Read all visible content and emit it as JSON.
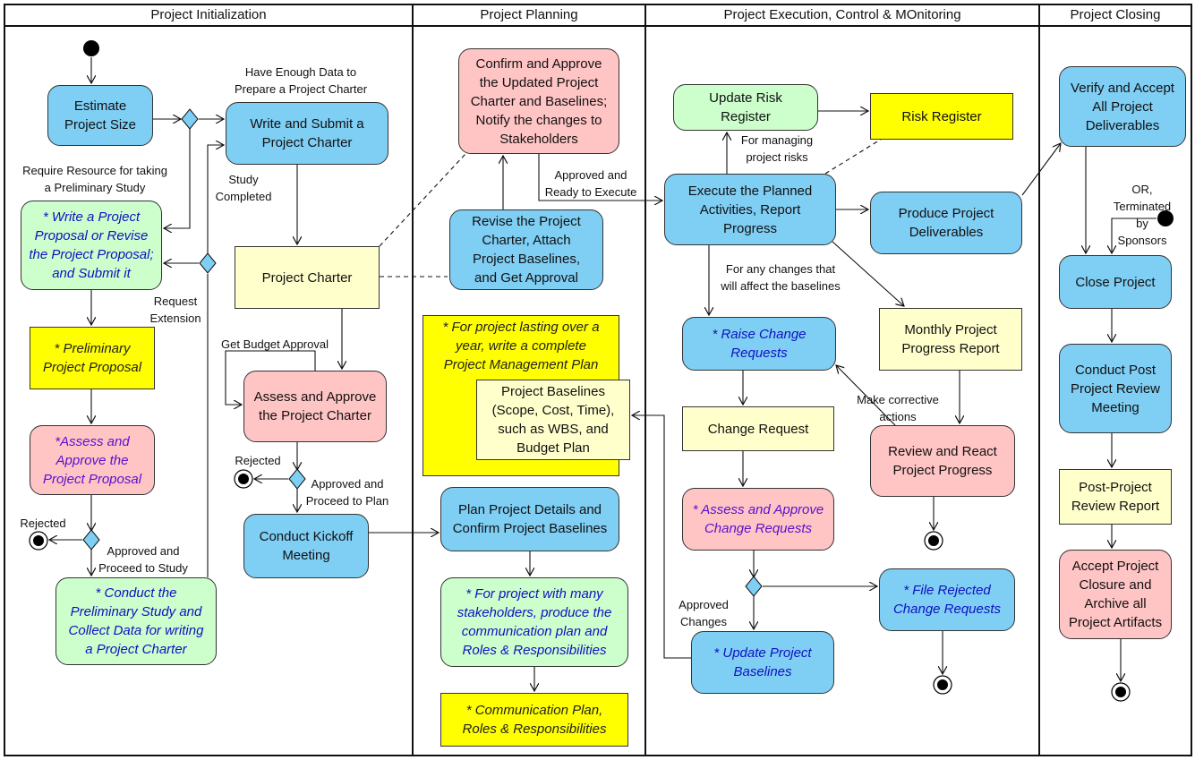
{
  "lanes": [
    {
      "id": "init",
      "title": "Project Initialization"
    },
    {
      "id": "plan",
      "title": "Project Planning"
    },
    {
      "id": "exec",
      "title": "Project Execution, Control & MOnitoring"
    },
    {
      "id": "close",
      "title": "Project Closing"
    }
  ],
  "nodes": [
    {
      "id": "n1",
      "text": "Estimate\nProject Size",
      "style": "blue rounded"
    },
    {
      "id": "n2",
      "text": "Write and Submit a\nProject Charter",
      "style": "blue rounded"
    },
    {
      "id": "n3",
      "text": "* Write a Project\nProposal or Revise\nthe Project Proposal;\nand Submit it",
      "style": "green rounded it"
    },
    {
      "id": "n4",
      "text": "Project Charter",
      "style": "lyellow"
    },
    {
      "id": "n5",
      "text": "* Preliminary\nProject Proposal",
      "style": "yellow itb"
    },
    {
      "id": "n6",
      "text": "*Assess and\nApprove the\nProject Proposal",
      "style": "pink rounded itp"
    },
    {
      "id": "n7",
      "text": "* Conduct the\nPreliminary Study and\nCollect Data for writing\na Project Charter",
      "style": "green rounded it"
    },
    {
      "id": "n8",
      "text": "Assess and Approve\nthe Project Charter",
      "style": "pink rounded"
    },
    {
      "id": "n9",
      "text": "Conduct Kickoff\nMeeting",
      "style": "blue rounded"
    },
    {
      "id": "n10",
      "text": "Confirm and Approve\nthe Updated Project\nCharter and Baselines;\nNotify the changes to\nStakeholders",
      "style": "pink rounded"
    },
    {
      "id": "n11",
      "text": "Revise the Project\nCharter, Attach\nProject Baselines,\nand Get Approval",
      "style": "blue rounded"
    },
    {
      "id": "n12",
      "text": "* For project lasting over a\nyear, write a complete\nProject Management Plan",
      "style": "yellow itb top"
    },
    {
      "id": "n13",
      "text": "Project Baselines\n(Scope, Cost, Time),\nsuch as WBS, and\nBudget Plan",
      "style": "lyellow"
    },
    {
      "id": "n14",
      "text": "Plan Project Details and\nConfirm Project Baselines",
      "style": "blue rounded"
    },
    {
      "id": "n15",
      "text": "* For project with many\nstakeholders, produce the\ncommunication plan and\nRoles & Responsibilities",
      "style": "green rounded it"
    },
    {
      "id": "n16",
      "text": "* Communication Plan,\nRoles & Responsibilities",
      "style": "yellow itb"
    },
    {
      "id": "n17",
      "text": "Update Risk\nRegister",
      "style": "green rounded"
    },
    {
      "id": "n18",
      "text": "Risk Register",
      "style": "yellow"
    },
    {
      "id": "n19",
      "text": "Execute the Planned\nActivities, Report\nProgress",
      "style": "blue rounded"
    },
    {
      "id": "n20",
      "text": "Produce Project\nDeliverables",
      "style": "blue rounded"
    },
    {
      "id": "n21",
      "text": "* Raise Change\nRequests",
      "style": "blue rounded it"
    },
    {
      "id": "n22",
      "text": "Monthly Project\nProgress Report",
      "style": "lyellow"
    },
    {
      "id": "n23",
      "text": "Change Request",
      "style": "lyellow"
    },
    {
      "id": "n24",
      "text": "Review and React\nProject Progress",
      "style": "pink rounded"
    },
    {
      "id": "n25",
      "text": "* Assess and Approve\nChange Requests",
      "style": "pink rounded itp"
    },
    {
      "id": "n26",
      "text": "* File Rejected\nChange Requests",
      "style": "blue rounded it"
    },
    {
      "id": "n27",
      "text": "* Update Project\nBaselines",
      "style": "blue rounded it"
    },
    {
      "id": "n28",
      "text": "Verify and Accept\nAll Project\nDeliverables",
      "style": "blue rounded"
    },
    {
      "id": "n29",
      "text": "Close Project",
      "style": "blue rounded"
    },
    {
      "id": "n30",
      "text": "Conduct Post\nProject Review\nMeeting",
      "style": "blue rounded"
    },
    {
      "id": "n31",
      "text": "Post-Project\nReview Report",
      "style": "lyellow"
    },
    {
      "id": "n32",
      "text": "Accept Project\nClosure and\nArchive all\nProject Artifacts",
      "style": "pink rounded"
    }
  ],
  "labels": [
    {
      "id": "l1",
      "text": "Have Enough Data to\nPrepare a Project Charter"
    },
    {
      "id": "l2",
      "text": "Require Resource for taking\na Preliminary Study"
    },
    {
      "id": "l3",
      "text": "Study\nCompleted"
    },
    {
      "id": "l4",
      "text": "Request\nExtension"
    },
    {
      "id": "l5",
      "text": "Get Budget Approval"
    },
    {
      "id": "l6",
      "text": "Rejected"
    },
    {
      "id": "l7",
      "text": "Approved and\nProceed to Plan"
    },
    {
      "id": "l8",
      "text": "Rejected"
    },
    {
      "id": "l9",
      "text": "Approved and\nProceed to Study"
    },
    {
      "id": "l10",
      "text": "Approved and\nReady to Execute"
    },
    {
      "id": "l11",
      "text": "For managing\nproject risks"
    },
    {
      "id": "l12",
      "text": "For any changes that\nwill affect the baselines"
    },
    {
      "id": "l13",
      "text": "Make corrective\nactions"
    },
    {
      "id": "l14",
      "text": "OR, Terminated\nby Sponsors"
    },
    {
      "id": "l15",
      "text": "Approved\nChanges"
    }
  ],
  "colors": {
    "action_blue": "#7fcef4",
    "green": "#ccffcc",
    "pink": "#ffc4c4",
    "yellow": "#ffff00",
    "light_yellow": "#ffffcc",
    "italic_text": "#1010c0"
  }
}
